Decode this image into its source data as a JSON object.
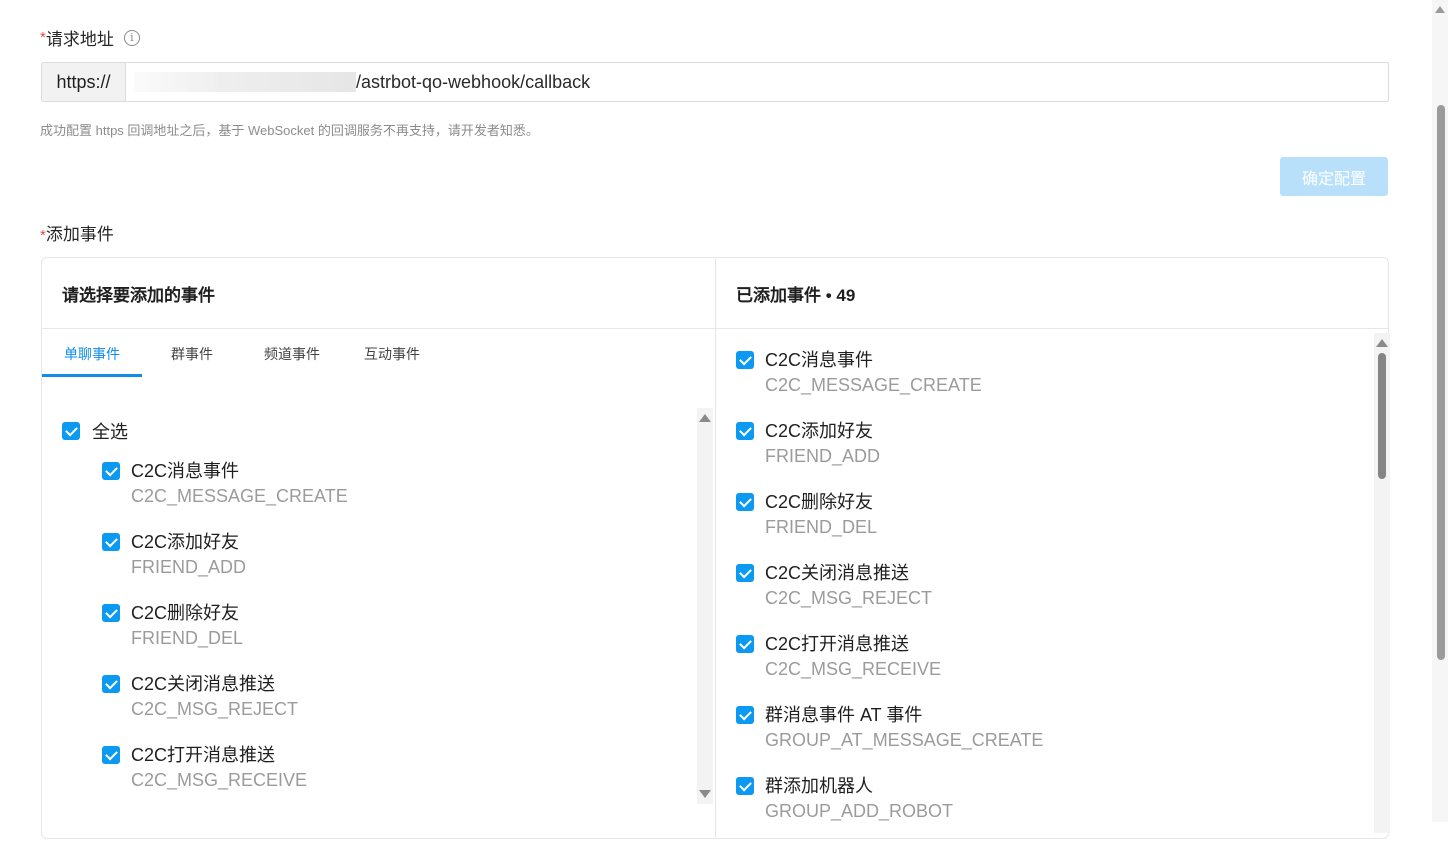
{
  "url_field": {
    "required_mark": "*",
    "label": "请求地址",
    "prefix": "https://",
    "value": "/astrbot-qo-webhook/callback",
    "hint": "成功配置 https 回调地址之后，基于 WebSocket 的回调服务不再支持，请开发者知悉。"
  },
  "confirm_button": "确定配置",
  "events_field": {
    "required_mark": "*",
    "label": "添加事件"
  },
  "left_panel": {
    "title": "请选择要添加的事件",
    "tabs": [
      "单聊事件",
      "群事件",
      "频道事件",
      "互动事件"
    ],
    "select_all": "全选",
    "events": [
      {
        "name": "C2C消息事件",
        "code": "C2C_MESSAGE_CREATE"
      },
      {
        "name": "C2C添加好友",
        "code": "FRIEND_ADD"
      },
      {
        "name": "C2C删除好友",
        "code": "FRIEND_DEL"
      },
      {
        "name": "C2C关闭消息推送",
        "code": "C2C_MSG_REJECT"
      },
      {
        "name": "C2C打开消息推送",
        "code": "C2C_MSG_RECEIVE"
      }
    ]
  },
  "right_panel": {
    "title": "已添加事件 • 49",
    "events": [
      {
        "name": "C2C消息事件",
        "code": "C2C_MESSAGE_CREATE"
      },
      {
        "name": "C2C添加好友",
        "code": "FRIEND_ADD"
      },
      {
        "name": "C2C删除好友",
        "code": "FRIEND_DEL"
      },
      {
        "name": "C2C关闭消息推送",
        "code": "C2C_MSG_REJECT"
      },
      {
        "name": "C2C打开消息推送",
        "code": "C2C_MSG_RECEIVE"
      },
      {
        "name": "群消息事件 AT 事件",
        "code": "GROUP_AT_MESSAGE_CREATE"
      },
      {
        "name": "群添加机器人",
        "code": "GROUP_ADD_ROBOT"
      }
    ]
  },
  "colors": {
    "accent": "#0c99f2",
    "confirm_disabled_bg": "#b8e0fb",
    "required": "#e5484d"
  }
}
